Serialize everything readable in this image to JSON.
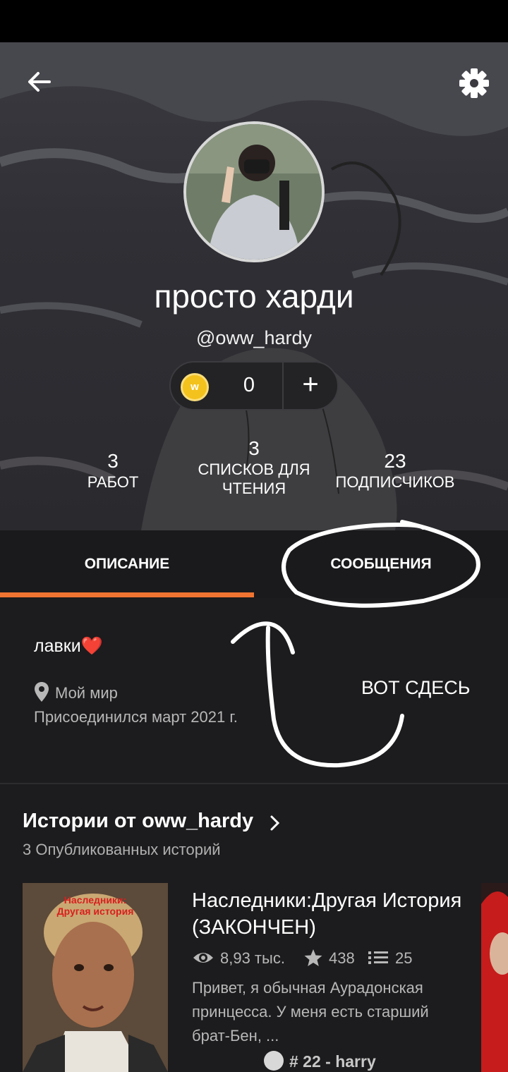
{
  "profile": {
    "display_name": "просто харди",
    "username": "@oww_hardy",
    "coins": "0",
    "coin_add": "+",
    "coin_letter": "w"
  },
  "stats": {
    "works": {
      "value": "3",
      "label": "РАБОТ"
    },
    "reading_lists": {
      "value": "3",
      "label_line1": "СПИСКОВ ДЛЯ",
      "label_line2": "ЧТЕНИЯ"
    },
    "followers": {
      "value": "23",
      "label": "ПОДПИСЧИКОВ"
    }
  },
  "tabs": [
    {
      "label": "ОПИСАНИЕ",
      "active": true
    },
    {
      "label": "СООБЩЕНИЯ",
      "active": false
    }
  ],
  "about": {
    "bio": "лавки❤️",
    "location": "Мой мир",
    "joined": "Присоединился март 2021 г."
  },
  "annotation": {
    "text": "ВОТ СДЕСЬ"
  },
  "stories": {
    "title": "Истории от oww_hardy",
    "subtitle": "3 Опубликованных историй",
    "items": [
      {
        "cover_text_line1": "Наследники:",
        "cover_text_line2": "Другая история",
        "title": "Наследники:Другая История (ЗАКОНЧЕН)",
        "reads": "8,93 тыс.",
        "votes": "438",
        "parts": "25",
        "description": "Привет, я обычная Аурадонская принцесса. У меня есть старший брат-Бен, ...",
        "tag": "# 22 - harry"
      }
    ]
  },
  "colors": {
    "accent": "#f07431",
    "coin": "#f4c21c",
    "background": "#1c1b1d"
  }
}
